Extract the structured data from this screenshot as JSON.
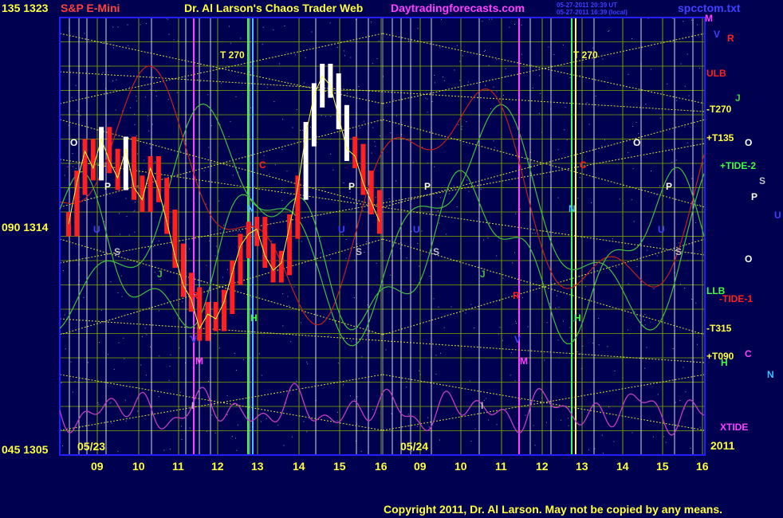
{
  "header": {
    "scale_top": "135  1323",
    "instrument": "S&P E-Mini",
    "title": "Dr. Al Larson's Chaos Trader Web",
    "site": "Daytradingforecasts.com",
    "stamp1": "05-27-2011 20:39 UT",
    "stamp2": "05-27-2011 16:39 (local)",
    "file": "spcctom.txt"
  },
  "scale_mid": "090  1314",
  "scale_bottom": "045  1305",
  "year": "2011",
  "copyright": "Copyright 2011, Dr. Al Larson. May not be copied by any means.",
  "colors": {
    "background": "#000050",
    "plot_border": "#2020ff",
    "grid": "#7aa000",
    "price_bars": "#ff2020",
    "price_bars_up": "#ffffff",
    "yellow_dotted": "#dddd40",
    "xtide": "#c040c0",
    "green_line": "#40c040",
    "red_line": "#c02020"
  },
  "chart_data": {
    "type": "line",
    "title": "S&P E-Mini",
    "x_tick_labels": [
      "09",
      "10",
      "11",
      "12",
      "13",
      "14",
      "15",
      "16",
      "09",
      "10",
      "11",
      "12",
      "13",
      "14",
      "15",
      "16"
    ],
    "date_labels": [
      "05/23",
      "05/24"
    ],
    "y_labels": [
      {
        "angle": "135",
        "price": "1323"
      },
      {
        "angle": "090",
        "price": "1314"
      },
      {
        "angle": "045",
        "price": "1305"
      }
    ],
    "ylim": [
      1305,
      1323
    ],
    "price_series": {
      "name": "price",
      "session": "05/23",
      "values": [
        1314.5,
        1316.2,
        1317.5,
        1316.8,
        1318.0,
        1317.1,
        1316.4,
        1317.6,
        1316.0,
        1315.5,
        1316.8,
        1315.9,
        1314.6,
        1313.2,
        1312.0,
        1311.4,
        1310.2,
        1310.8,
        1310.6,
        1311.3,
        1312.5,
        1313.6,
        1314.1,
        1314.3,
        1313.2,
        1312.6,
        1312.9,
        1314.4,
        1316.0,
        1318.2,
        1319.8,
        1320.6,
        1320.2,
        1318.9,
        1317.6,
        1317.3,
        1316.2,
        1315.4,
        1314.6
      ]
    },
    "series_right_labels": [
      {
        "text": "M",
        "color": "#ff40ff"
      },
      {
        "text": "V",
        "color": "#4040ff"
      },
      {
        "text": "R",
        "color": "#ff2020"
      },
      {
        "text": "ULB",
        "color": "#ff2020"
      },
      {
        "text": "J",
        "color": "#40d040"
      },
      {
        "text": "-T270",
        "color": "#ffff40"
      },
      {
        "text": "+T135",
        "color": "#ffff40"
      },
      {
        "text": "O",
        "color": "#ffffff"
      },
      {
        "text": "+TIDE-2",
        "color": "#40ff40"
      },
      {
        "text": "S",
        "color": "#c0c0c0"
      },
      {
        "text": "P",
        "color": "#ffffff"
      },
      {
        "text": "U",
        "color": "#4040ff"
      },
      {
        "text": "O",
        "color": "#ffffff"
      },
      {
        "text": "LLB",
        "color": "#40ff40"
      },
      {
        "text": "-TIDE-1",
        "color": "#ff2020"
      },
      {
        "text": "-T315",
        "color": "#ffff40"
      },
      {
        "text": "+T090",
        "color": "#ffff40"
      },
      {
        "text": "C",
        "color": "#ff40ff"
      },
      {
        "text": "H",
        "color": "#40ff40"
      },
      {
        "text": "N",
        "color": "#40c0ff"
      },
      {
        "text": "XTIDE",
        "color": "#ff40ff"
      }
    ],
    "inline_markers": [
      {
        "text": "T  270",
        "color": "#ffff40",
        "day": 0
      },
      {
        "text": "T  270",
        "color": "#ffff40",
        "day": 1
      },
      {
        "text": "O",
        "color": "#ffffff",
        "day": 0
      },
      {
        "text": "O",
        "color": "#ffffff",
        "day": 1
      },
      {
        "text": "P",
        "color": "#ffffff",
        "day": 0
      },
      {
        "text": "P",
        "color": "#ffffff",
        "day": 0
      },
      {
        "text": "P",
        "color": "#ffffff",
        "day": 1
      },
      {
        "text": "P",
        "color": "#ffffff",
        "day": 1
      },
      {
        "text": "C",
        "color": "#ff2020",
        "day": 0
      },
      {
        "text": "C",
        "color": "#ff2020",
        "day": 1
      },
      {
        "text": "N",
        "color": "#40c0ff",
        "day": 0
      },
      {
        "text": "N",
        "color": "#40c0ff",
        "day": 1
      },
      {
        "text": "U",
        "color": "#4040ff",
        "day": 0
      },
      {
        "text": "U",
        "color": "#4040ff",
        "day": 0
      },
      {
        "text": "U",
        "color": "#4040ff",
        "day": 1
      },
      {
        "text": "U",
        "color": "#4040ff",
        "day": 1
      },
      {
        "text": "S",
        "color": "#c0c0c0",
        "day": 0
      },
      {
        "text": "S",
        "color": "#c0c0c0",
        "day": 0
      },
      {
        "text": "S",
        "color": "#c0c0c0",
        "day": 1
      },
      {
        "text": "S",
        "color": "#c0c0c0",
        "day": 1
      },
      {
        "text": "J",
        "color": "#40c040",
        "day": 0
      },
      {
        "text": "J",
        "color": "#40c040",
        "day": 1
      },
      {
        "text": "R",
        "color": "#ff2020",
        "day": 0
      },
      {
        "text": "R",
        "color": "#ff2020",
        "day": 1
      },
      {
        "text": "H",
        "color": "#40ff40",
        "day": 0
      },
      {
        "text": "H",
        "color": "#40ff40",
        "day": 1
      },
      {
        "text": "V",
        "color": "#4040ff",
        "day": 0
      },
      {
        "text": "V",
        "color": "#4040ff",
        "day": 1
      },
      {
        "text": "M",
        "color": "#ff40ff",
        "day": 0
      },
      {
        "text": "M",
        "color": "#ff40ff",
        "day": 1
      },
      {
        "text": "I",
        "color": "#c0c0c0",
        "day": 0
      },
      {
        "text": "I",
        "color": "#c0c0c0",
        "day": 1
      }
    ]
  }
}
